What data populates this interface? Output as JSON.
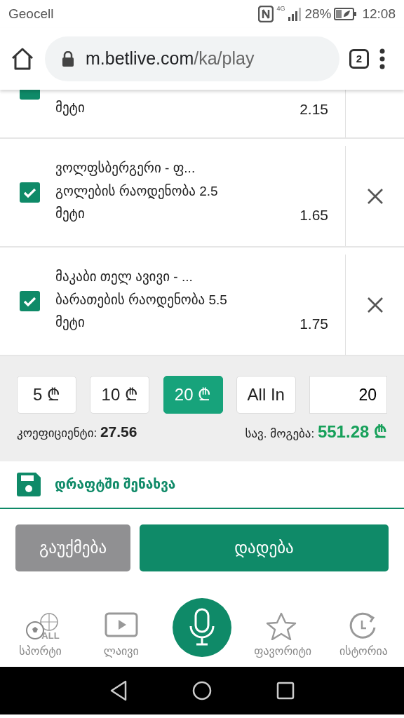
{
  "status_bar": {
    "carrier": "Geocell",
    "network": "4G",
    "battery": "28%",
    "time": "12:08"
  },
  "browser": {
    "url_host": "m.betlive.com",
    "url_path": "/ka/play",
    "tab_count": "2"
  },
  "bets": [
    {
      "kind": "partial",
      "checked": true,
      "pick": "მეტი",
      "odds": "2.15"
    },
    {
      "kind": "full",
      "checked": true,
      "title": "ვოლფსბერგერი - ფ...",
      "market": "გოლების რაოდენობა 2.5",
      "pick": "მეტი",
      "odds": "1.65"
    },
    {
      "kind": "full",
      "checked": true,
      "title": "მაკაბი თელ ავივი - ...",
      "market": "ბარათების რაოდენობა 5.5",
      "pick": "მეტი",
      "odds": "1.75"
    }
  ],
  "stakes": [
    {
      "label": "5 ₾",
      "selected": false
    },
    {
      "label": "10 ₾",
      "selected": false
    },
    {
      "label": "20 ₾",
      "selected": true
    },
    {
      "label": "All In",
      "selected": false
    }
  ],
  "stake_input": "20",
  "coefficient": {
    "label": "კოეფიციენტი:",
    "value": "27.56"
  },
  "payout": {
    "label": "სავ. მოგება:",
    "value": "551.28 ₾"
  },
  "save_draft": "დრაფტში შენახვა",
  "cancel_button": "გაუქმება",
  "place_button": "დადება",
  "bottom_nav": [
    {
      "kind": "sports",
      "label": "სპორტი",
      "icon_text": "ALL"
    },
    {
      "kind": "live",
      "label": "ლაივი"
    },
    {
      "kind": "mic"
    },
    {
      "kind": "favorites",
      "label": "ფავორიტი"
    },
    {
      "kind": "history",
      "label": "ისტორია"
    }
  ]
}
